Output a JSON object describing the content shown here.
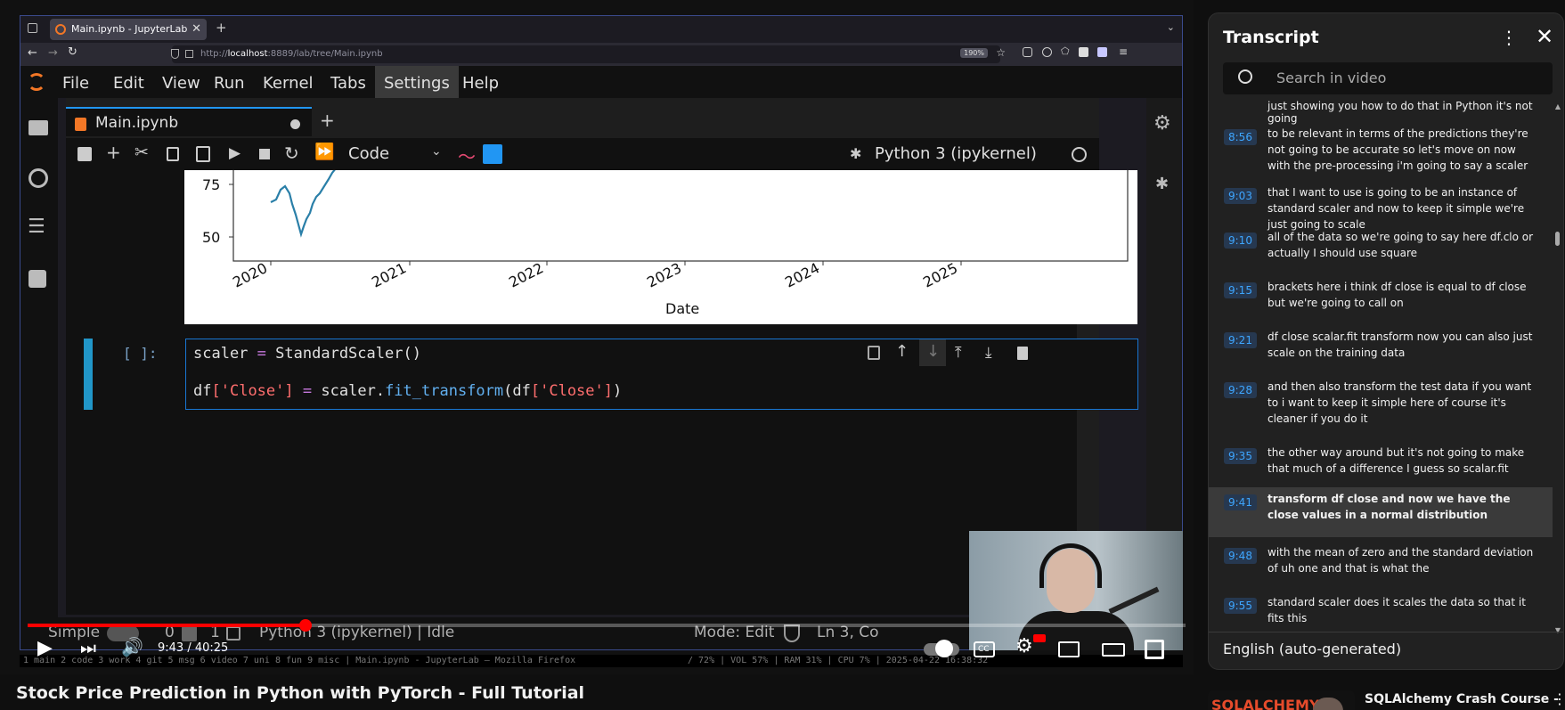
{
  "browser": {
    "tab_title": "Main.ipynb - JupyterLab",
    "url_prefix": "http://",
    "url_host": "localhost",
    "url_rest": ":8889/lab/tree/Main.ipynb",
    "zoom": "190%"
  },
  "jupyter": {
    "menu": [
      "File",
      "Edit",
      "View",
      "Run",
      "Kernel",
      "Tabs",
      "Settings",
      "Help"
    ],
    "active_menu": "Settings",
    "notebook_tab": "Main.ipynb",
    "cell_type": "Code",
    "kernel_name": "Python 3 (ipykernel)",
    "plot": {
      "y_ticks": [
        "75",
        "50"
      ],
      "x_ticks": [
        "2020",
        "2021",
        "2022",
        "2023",
        "2024",
        "2025"
      ],
      "xlabel": "Date"
    },
    "cell_prompt": "[ ]:",
    "code_line1": {
      "var": "scaler",
      "op": "=",
      "call": "StandardScaler()"
    },
    "code_line2": {
      "df": "df",
      "key": "'Close'",
      "op": "=",
      "obj": "scaler",
      "method": "fit_transform"
    },
    "status": {
      "mode_toggle": "Simple",
      "count1": "0",
      "count2": "1",
      "kernel_status": "Python 3 (ipykernel) | Idle",
      "mode": "Mode: Edit",
      "cursor": "Ln 3, Co"
    }
  },
  "i3bar": {
    "left": "1 main  2 code  3 work  4 git  5 msg  6 video  7 uni  8 fun  9 misc | Main.ipynb - JupyterLab — Mozilla Firefox",
    "right": "/ 72% | VOL 57% | RAM 31% | CPU 7% | 2025-04-22 16:38:32"
  },
  "player": {
    "time": "9:43 / 40:25",
    "progress": 0.24,
    "title": "Stock Price Prediction in Python with PyTorch - Full Tutorial"
  },
  "transcript": {
    "title": "Transcript",
    "search_placeholder": "Search in video",
    "top_partial": "just showing you how to do that in Python it's not going",
    "segments": [
      {
        "time": "8:56",
        "text": "to be relevant in terms of the predictions they're not going to be accurate so let's move on now with the pre-processing i'm going to say a scaler"
      },
      {
        "time": "9:03",
        "text": "that I want to use is going to be an instance of standard scaler and now to keep it simple we're just going to scale"
      },
      {
        "time": "9:10",
        "text": "all of the data so we're going to say here df.clo or actually I should use square"
      },
      {
        "time": "9:15",
        "text": "brackets here i think df close is equal to df close but we're going to call on"
      },
      {
        "time": "9:21",
        "text": "df close scalar.fit transform now you can also just scale on the training data"
      },
      {
        "time": "9:28",
        "text": "and then also transform the test data if you want to i want to keep it simple here of course it's cleaner if you do it"
      },
      {
        "time": "9:35",
        "text": "the other way around but it's not going to make that much of a difference I guess so scalar.fit"
      },
      {
        "time": "9:41",
        "text": "transform df close and now we have the close values in a normal distribution",
        "active": true
      },
      {
        "time": "9:48",
        "text": "with the mean of zero and the standard deviation of uh one and that is what the"
      },
      {
        "time": "9:55",
        "text": "standard scaler does it scales the data so that it fits this"
      }
    ],
    "language": "English (auto-generated)"
  },
  "next_video": {
    "title": "SQLAlchemy Crash Course -",
    "thumb_text": "SQLALCHEMY"
  }
}
